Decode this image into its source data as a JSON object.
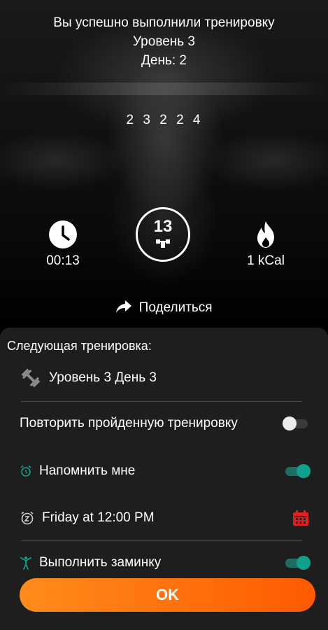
{
  "hero": {
    "title": "Вы успешно выполнили тренировку",
    "level": "Уровень 3",
    "day": "День: 2",
    "reps": [
      "2",
      "3",
      "2",
      "2",
      "4"
    ]
  },
  "stats": {
    "time": "00:13",
    "exercises": "13",
    "calories": "1 kCal"
  },
  "share_label": "Поделиться",
  "panel": {
    "next_title": "Следующая тренировка:",
    "next_workout": "Уровень 3 День 3",
    "repeat_label": "Повторить пройденную тренировку",
    "repeat_enabled": false,
    "remind_label": "Напомнить мне",
    "remind_enabled": true,
    "reminder_time": "Friday at 12:00 PM",
    "cooldown_label": "Выполнить заминку",
    "cooldown_enabled": true
  },
  "ok_label": "OK",
  "colors": {
    "accent_teal": "#10a08c",
    "button_gradient_start": "#ff8c1a",
    "button_gradient_end": "#ff5a00",
    "calendar_red": "#e02020",
    "panel_bg": "#1e1e1e"
  },
  "icons": {
    "time": "clock-icon",
    "exercises": "dumbbell-icon",
    "calories": "flame-icon",
    "share": "share-arrow-icon",
    "next": "dumbbell-icon",
    "remind": "alarm-icon",
    "time_row": "snooze-alarm-icon",
    "calendar": "calendar-icon",
    "cooldown": "stretch-person-icon"
  }
}
